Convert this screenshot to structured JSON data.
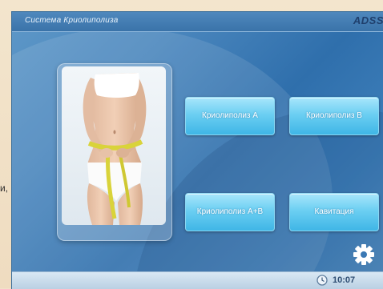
{
  "page": {
    "side_text_fragment": "и,"
  },
  "header": {
    "app_title": "Система Криолиполиза",
    "brand": "ADSS"
  },
  "menu": {
    "buttons": [
      {
        "label": "Криолиполиз А"
      },
      {
        "label": "Криолиполиз B"
      },
      {
        "label": "Криолиполиз А+В"
      },
      {
        "label": "Кавитация"
      }
    ]
  },
  "photo": {
    "icon": "woman-measuring-tape-photo"
  },
  "settings": {
    "icon": "gear-icon"
  },
  "statusbar": {
    "time": "10:07",
    "icon": "clock-icon"
  },
  "colors": {
    "screen_blue": "#3a78b4",
    "button_cyan": "#5cc8ef",
    "titlebar_blue": "#4580b6",
    "statusbar": "#c8dbea"
  }
}
